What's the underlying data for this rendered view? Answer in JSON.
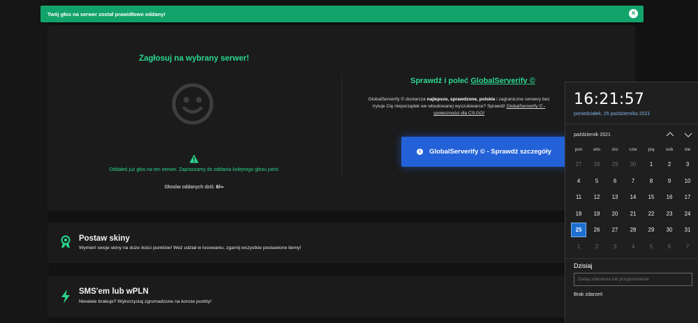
{
  "toast": {
    "message": "Twój głos na serwer został prawidłowo oddany!"
  },
  "vote": {
    "title": "Zagłosuj na wybrany serwer!",
    "warning": "Oddałeś już głos na ten serwer. Zapraszamy do oddania kolejnego głosu jutro!",
    "count_label": "Głosów oddanych dziś:",
    "count_value": "6/∞"
  },
  "globalserverify": {
    "heading_prefix": "Sprawdź i poleć",
    "heading_link": "GlobalServerify ©",
    "desc_1": "GlobalServerify © dostarcza",
    "desc_bold_1": "najlepsze, sprawdzone, polskie",
    "desc_2": "i zagraniczne serwery bez",
    "desc_3": "Irytuje Cię nieporządek we wbudowanej wyszukiwarce? Sprawdź",
    "desc_link": "GlobalServerify © -",
    "desc_4": "społeczności dla CS:GO!",
    "button_label": "GlobalServerify © - Sprawdź szczegóły"
  },
  "features": [
    {
      "title": "Postaw skiny",
      "description": "Wymień swoje skiny na duże ilości punktów! Weź udział w losowaniu, zgarnij wszystkie postawione itemy!"
    },
    {
      "title": "SMS'em lub wPLN",
      "description": "Niewiele brakuje? Wykorzystaj zgromadzone na koncie punkty!"
    }
  ],
  "calendar": {
    "time": "16:21:57",
    "date": "poniedziałek, 25 października 2021",
    "month_label": "październik 2021",
    "weekdays": [
      "pon",
      "wto",
      "śro",
      "czw",
      "pią",
      "sob",
      "nie"
    ],
    "weeks": [
      [
        "27",
        "28",
        "29",
        "30",
        "1",
        "2",
        "3"
      ],
      [
        "4",
        "5",
        "6",
        "7",
        "8",
        "9",
        "10"
      ],
      [
        "11",
        "12",
        "13",
        "14",
        "15",
        "16",
        "17"
      ],
      [
        "18",
        "19",
        "20",
        "21",
        "22",
        "23",
        "24"
      ],
      [
        "25",
        "26",
        "27",
        "28",
        "29",
        "30",
        "31"
      ],
      [
        "1",
        "2",
        "3",
        "4",
        "5",
        "6",
        "7"
      ]
    ],
    "today_heading": "Dzisiaj",
    "event_placeholder": "Dodaj zdarzenie lub przypomnienie",
    "no_events": "Brak zdarzeń"
  },
  "colors": {
    "accent_green": "#2bd68f",
    "toast_green": "#12a36a",
    "button_blue": "#2361d8",
    "today_blue": "#1d6fd1"
  }
}
